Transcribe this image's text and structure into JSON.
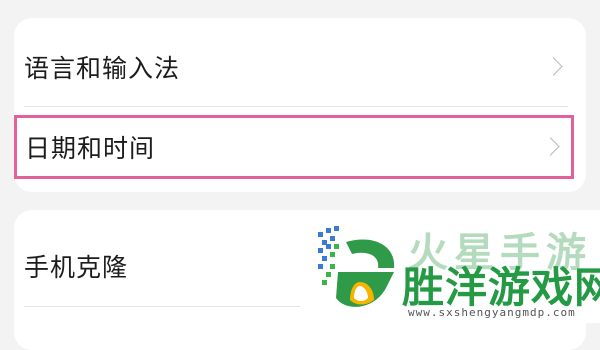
{
  "settings": {
    "group1": {
      "items": [
        {
          "label": "语言和输入法",
          "icon": "chevron-right-icon"
        },
        {
          "label": "日期和时间",
          "icon": "chevron-right-icon",
          "highlighted": true
        }
      ]
    },
    "group2": {
      "items": [
        {
          "label": "手机克隆"
        }
      ]
    }
  },
  "watermark": {
    "top_text": "火星手游",
    "title": "胜洋游戏网",
    "url": "www.sxshengyangmdp.com"
  },
  "colors": {
    "background": "#f3f3f4",
    "card": "#ffffff",
    "highlight_border": "#e0619b",
    "watermark_green": "#259a45"
  }
}
